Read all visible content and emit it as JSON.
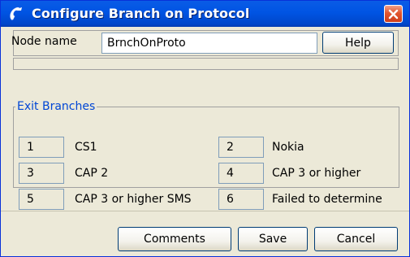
{
  "window": {
    "title": "Configure Branch on Protocol"
  },
  "node": {
    "label": "Node name",
    "value": "BrnchOnProto",
    "help_label": "Help"
  },
  "exit_branches": {
    "legend": "Exit Branches",
    "items": [
      {
        "num": "1",
        "label": "CS1"
      },
      {
        "num": "2",
        "label": "Nokia"
      },
      {
        "num": "3",
        "label": "CAP 2"
      },
      {
        "num": "4",
        "label": "CAP 3 or higher"
      },
      {
        "num": "5",
        "label": "CAP 3 or higher SMS"
      },
      {
        "num": "6",
        "label": "Failed to determine"
      }
    ]
  },
  "buttons": {
    "comments": "Comments",
    "save": "Save",
    "cancel": "Cancel"
  },
  "icons": {
    "title": "telephone-handset-icon",
    "close": "close-icon"
  },
  "colors": {
    "titlebar": "#0054e3",
    "close": "#e2562e",
    "legend": "#0046d5",
    "window_bg": "#ece9d8"
  }
}
